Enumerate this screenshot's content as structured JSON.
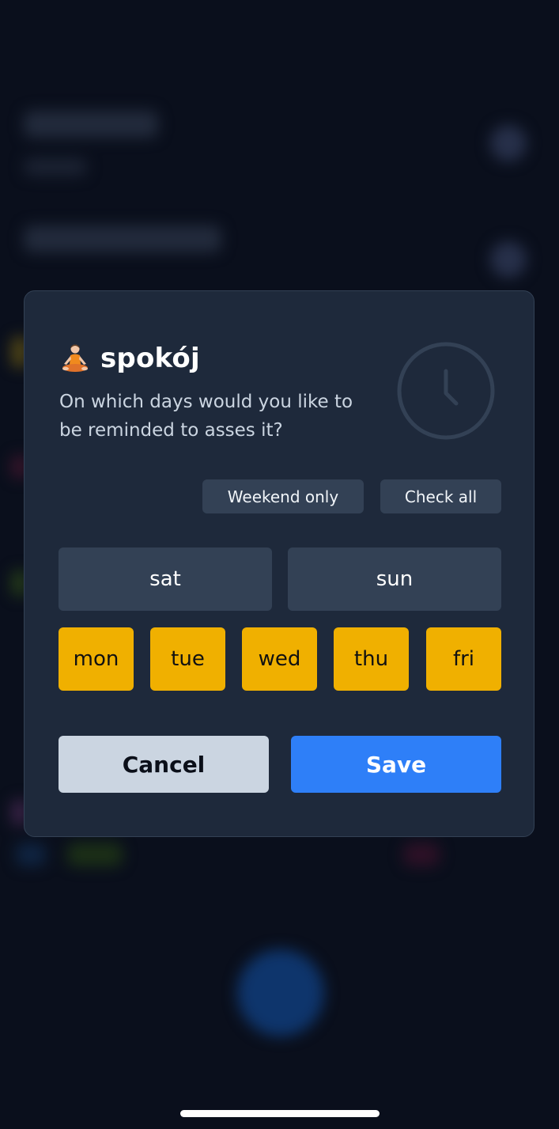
{
  "colors": {
    "background": "#0a0f1c",
    "modal_background": "#1e293b",
    "neutral_button": "#334155",
    "selected_day": "#f0b000",
    "cancel_button": "#cbd5e1",
    "save_button": "#2e7ff8"
  },
  "dialog": {
    "habit_icon": "meditation-icon",
    "habit_name": "spokój",
    "question": "On which days would you like to be reminded to asses it?",
    "decor_icon": "clock-icon",
    "quick_select": {
      "weekend_only_label": "Weekend only",
      "check_all_label": "Check all"
    },
    "weekend_days": [
      {
        "label": "sat",
        "selected": false
      },
      {
        "label": "sun",
        "selected": false
      }
    ],
    "week_days": [
      {
        "label": "mon",
        "selected": true
      },
      {
        "label": "tue",
        "selected": true
      },
      {
        "label": "wed",
        "selected": true
      },
      {
        "label": "thu",
        "selected": true
      },
      {
        "label": "fri",
        "selected": true
      }
    ],
    "actions": {
      "cancel_label": "Cancel",
      "save_label": "Save"
    }
  }
}
